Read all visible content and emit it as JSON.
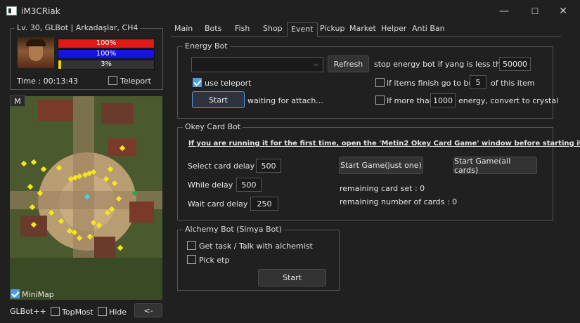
{
  "window": {
    "title": "iM3CRiak",
    "minimize": "—",
    "maximize": "☐",
    "close": "✕"
  },
  "character": {
    "header": "Lv. 30, GLBot | Arkadaşlar, CH4",
    "hp": "100%",
    "mp": "100%",
    "exp": "3%",
    "exp_fraction": 0.03,
    "time": "Time : 00:13:43",
    "teleport_label": "Teleport"
  },
  "minimap": {
    "m_button": "M",
    "label": "MiniMap",
    "checked": true
  },
  "footer": {
    "brand": "GLBot++",
    "topmost": "TopMost",
    "hide": "Hide",
    "collapse": "<-"
  },
  "tabs": [
    "Main",
    "Bots",
    "Fish",
    "Shop",
    "Event",
    "Pickup",
    "Market",
    "Helper",
    "Anti Ban"
  ],
  "active_tab": "Event",
  "energy": {
    "title": "Energy Bot",
    "refresh": "Refresh",
    "yang_text": "stop energy bot if yang is less than",
    "yang_value": "50000",
    "use_teleport": "use teleport",
    "items_text": "if items finish go to buy",
    "items_value": "5",
    "items_suffix": "of this item",
    "start": "Start",
    "status": "waiting for attach...",
    "more_than": "If more than",
    "energy_value": "1000",
    "energy_suffix": "energy, convert to crystal"
  },
  "okey": {
    "title": "Okey Card Bot",
    "notice": "If you are running it for the first time, open the 'Metin2 Okey Card Game' window before starting it.",
    "select_label": "Select card delay :",
    "select_value": "500",
    "while_label": "While delay :",
    "while_value": "500",
    "wait_label": "Wait card delay :",
    "wait_value": "250",
    "start_one": "Start Game(just one)",
    "start_all": "Start Game(all cards)",
    "remaining_set": "remaining card set : 0",
    "remaining_cards": "remaining number of cards : 0"
  },
  "alchemy": {
    "title": "Alchemy Bot (Simya Bot)",
    "task": "Get task / Talk with alchemist",
    "pick": "Pick etp",
    "start": "Start"
  },
  "colors": {
    "hp": "#e01818",
    "mp": "#1414e0",
    "exp": "#e8d800",
    "accent": "#4d9de0"
  }
}
